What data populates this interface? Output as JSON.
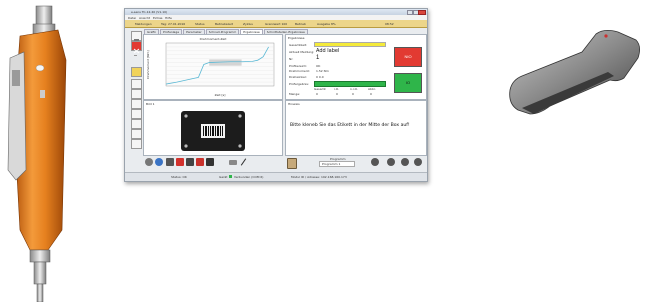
{
  "window": {
    "title": "e-sens TC-12.40 (V1.10)",
    "menu": [
      "Datei",
      "Ansicht",
      "Extras",
      "Hilfe"
    ],
    "status_items": [
      "Meldungen",
      "Tag: 27.01.2016",
      "Status",
      "Betriebszeit",
      "Zyklus",
      "Grenzwert 100",
      "Betrieb",
      "Ausgabe 8%"
    ],
    "status_time": "08:52"
  },
  "tabs": [
    "Grafik",
    "Prüfanlage",
    "Parameter",
    "Schnell-Programm",
    "Ergebnisse",
    "Schnittstellen-Ergebnisse"
  ],
  "chart_panel": {
    "title": "Drehmoment-Zeit",
    "ylabel": "Drehmoment [Nm]",
    "xlabel": "Zeit [s]"
  },
  "chart_data": {
    "type": "line",
    "title": "Drehmoment-Zeit",
    "xlabel": "Zeit [s]",
    "ylabel": "Drehmoment [Nm]",
    "x": [
      0,
      2,
      4,
      6,
      7,
      8,
      10,
      12,
      14,
      16,
      17,
      18,
      19
    ],
    "series": [
      {
        "values": [
          0.5,
          1.0,
          1.6,
          2.2,
          5.5,
          6.0,
          6.1,
          6.2,
          6.2,
          6.3,
          6.6,
          7.5,
          10.0
        ]
      }
    ],
    "ylim": [
      0,
      11
    ],
    "xlim": [
      0,
      20
    ],
    "grid": true
  },
  "results_panel": {
    "title": "Ergebnisse",
    "rows": [
      {
        "label": "Gesamtzeit:",
        "value": "0:00:00"
      },
      {
        "label": "Aktuell Meldung:",
        "value": "Add label"
      },
      {
        "label": "Nr:",
        "value": "1"
      },
      {
        "label": "Prüfbereich:",
        "value": "OK"
      },
      {
        "label": "Drehmoment:",
        "value": "1.52 Nm"
      },
      {
        "label": "Drehwinkel:",
        "value": "0     0.0"
      },
      {
        "label": "Prüfergebnis:",
        "value": ""
      }
    ],
    "counter_headers": [
      "Gesamt",
      "i.O.",
      "n.i.O.",
      "Abbr."
    ],
    "counter_label": "Menge:",
    "counter_values": [
      "0",
      "0",
      "0",
      "0"
    ],
    "nio_button": "NIO",
    "io_button": "IO"
  },
  "image_panel": {
    "title": "Bild 1"
  },
  "message_panel": {
    "title": "Hinweis",
    "text": "Bitte kleneb Sie das Etikett in der Mitte der Box auf!"
  },
  "toolbar": {
    "program_label": "Programm",
    "program_value": "Programm 1"
  },
  "footer": {
    "left": "Status: OK",
    "mid": "Gerät",
    "status_text": "Verbunden (COM 6)",
    "right": "Modul ID / Adresse: 192.168.160.173"
  },
  "colors": {
    "accent_red": "#e23a32",
    "accent_green": "#2fb54a",
    "status_yellow": "#ecd58a",
    "tool_orange": "#e98a24"
  }
}
